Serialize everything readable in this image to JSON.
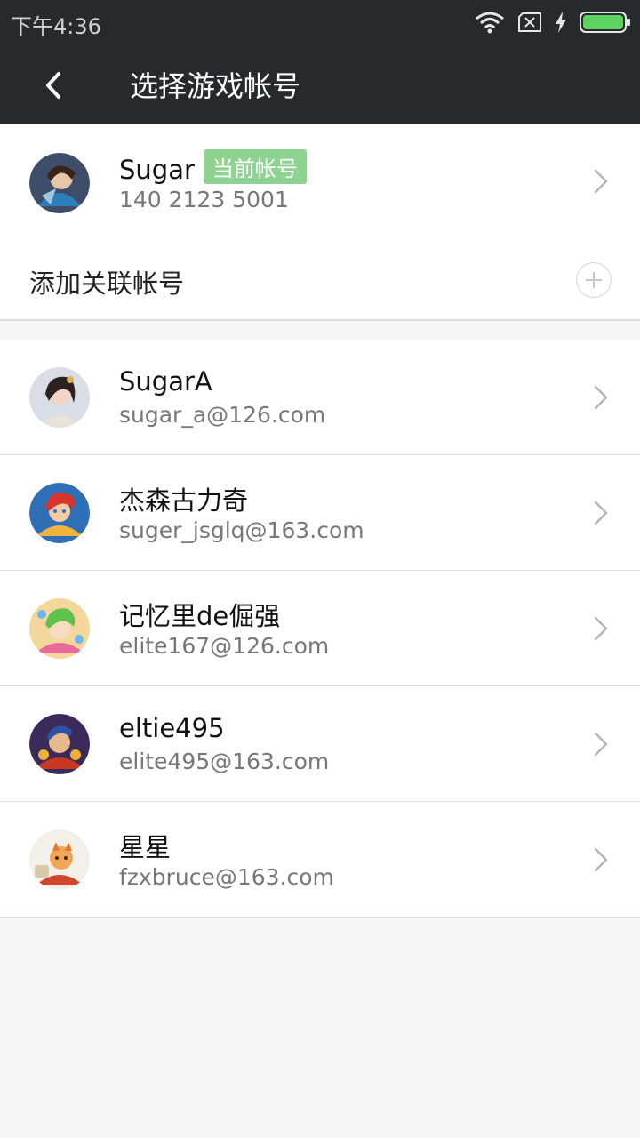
{
  "status_bar": {
    "time": "下午4:36"
  },
  "app_bar": {
    "title": "选择游戏帐号"
  },
  "current_account": {
    "name": "Sugar",
    "badge": "当前帐号",
    "phone": "140 2123 5001"
  },
  "add_linked_label": "添加关联帐号",
  "accounts": [
    {
      "name": "SugarA",
      "email": "sugar_a@126.com"
    },
    {
      "name": "杰森古力奇",
      "email": "suger_jsglq@163.com"
    },
    {
      "name": "记忆里de倔强",
      "email": "elite167@126.com"
    },
    {
      "name": "eltie495",
      "email": "elite495@163.com"
    },
    {
      "name": "星星",
      "email": "fzxbruce@163.com"
    }
  ],
  "colors": {
    "bar": "#262a2d",
    "badge": "#8fd393",
    "battery": "#5fd35f",
    "background": "#f7f7f7"
  },
  "icons": [
    "back-arrow-icon",
    "wifi-icon",
    "sim-x-icon",
    "charging-bolt-icon",
    "battery-icon",
    "chevron-right-icon",
    "add-circle-icon"
  ]
}
